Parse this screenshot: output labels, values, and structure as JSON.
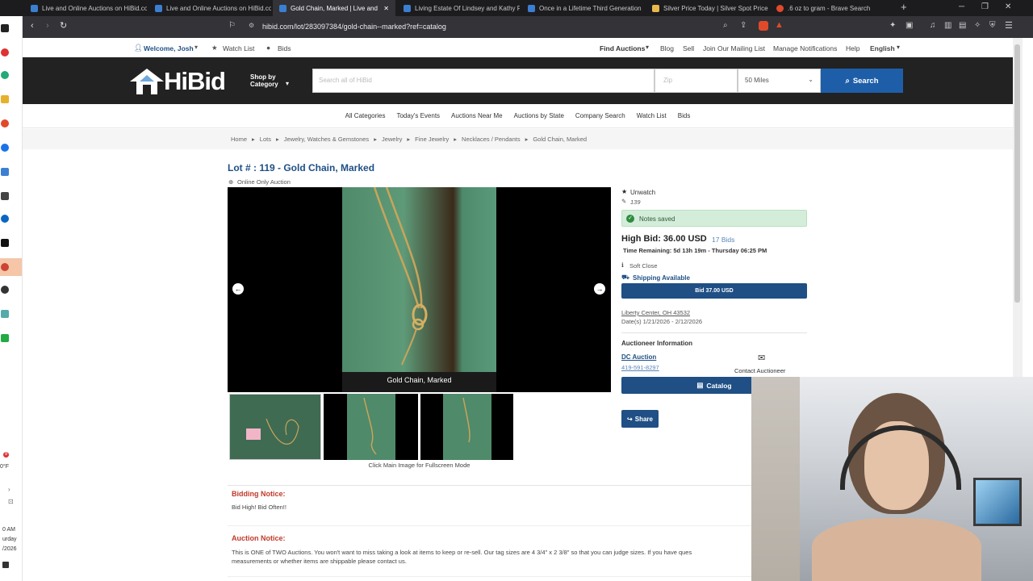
{
  "browser": {
    "tabs": [
      {
        "label": "Live and Online Auctions on HiBid.co"
      },
      {
        "label": "Live and Online Auctions on HiBid.co"
      },
      {
        "label": "Gold Chain, Marked | Live and O"
      },
      {
        "label": "Living Estate Of Lindsey and Kathy R"
      },
      {
        "label": "Once in a Lifetime Third Generation"
      },
      {
        "label": "Silver Price Today | Silver Spot Price"
      },
      {
        "label": ".6 oz to gram - Brave Search"
      }
    ],
    "url": "hibid.com/lot/283097384/gold-chain--marked?ref=catalog"
  },
  "taskbar": {
    "weather": "0°F",
    "badge": "9",
    "time": "0 AM",
    "day": "urday",
    "date": "/2026"
  },
  "topnav": {
    "welcome": "Welcome, Josh",
    "watchlist": "Watch List",
    "bids": "Bids",
    "right": [
      "Find Auctions",
      "Blog",
      "Sell",
      "Join Our Mailing List",
      "Manage Notifications",
      "Help",
      "English"
    ]
  },
  "header": {
    "logo": "HiBid",
    "shop_line1": "Shop by",
    "shop_line2": "Category",
    "search_placeholder": "Search all of HiBid",
    "zip_placeholder": "Zip",
    "miles": "50 Miles",
    "search_button": "Search"
  },
  "catnav": [
    "All Categories",
    "Today's Events",
    "Auctions Near Me",
    "Auctions by State",
    "Company Search",
    "Watch List",
    "Bids"
  ],
  "breadcrumbs": [
    "Home",
    "Lots",
    "Jewelry, Watches & Gemstones",
    "Jewelry",
    "Fine Jewelry",
    "Necklaces / Pendants",
    "Gold Chain, Marked"
  ],
  "lot": {
    "title": "Lot # : 119 - Gold Chain, Marked",
    "auction_type": "Online Only Auction",
    "image_caption": "Gold Chain, Marked",
    "thumb_hint": "Click Main Image for Fullscreen Mode"
  },
  "bid": {
    "unwatch": "Unwatch",
    "note": "139",
    "notes_saved": "Notes saved",
    "high_bid": "High Bid: 36.00 USD",
    "bids_count": "17 Bids",
    "time_remaining": "Time Remaining: 5d 13h 19m - Thursday 06:25 PM",
    "soft_close": "Soft Close",
    "shipping": "Shipping Available",
    "bid_button": "Bid 37.00 USD",
    "location": "Liberty Center, OH 43532",
    "dates": "Date(s) 1/21/2026 - 2/12/2026",
    "auctioneer_heading": "Auctioneer Information",
    "auctioneer_name": "DC Auction",
    "auctioneer_phone": "419-591-8297",
    "contact": "Contact Auctioneer",
    "catalog": "Catalog",
    "share": "Share"
  },
  "notices": {
    "bidding_heading": "Bidding Notice:",
    "bidding_text": "Bid High! Bid Often!!",
    "auction_heading": "Auction Notice:",
    "auction_text_1": "This is ONE of TWO Auctions. You won't want to miss taking a look at items to keep or re-sell. Our tag sizes are 4 3/4\" x 2 3/8\" so that you can judge sizes. If you have ques",
    "auction_text_2": "measurements or whether items are shippable please contact us."
  },
  "colors": {
    "brand_blue": "#1f4f85",
    "header_dark": "#222222",
    "notice_red": "#c0392b",
    "saved_green": "#d4edda"
  }
}
